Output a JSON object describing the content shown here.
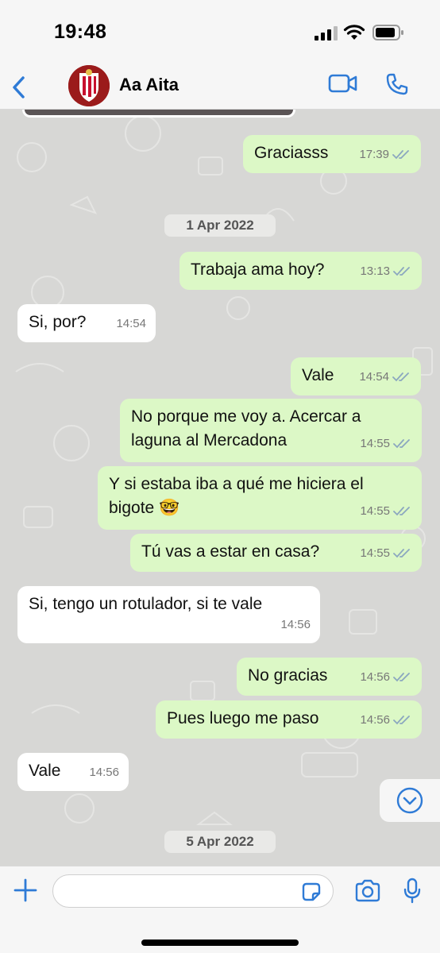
{
  "status_bar": {
    "time": "19:48"
  },
  "header": {
    "contact_name": "Aa Aita"
  },
  "colors": {
    "accent": "#2f7bd6",
    "outgoing_bubble": "#dcf8c6",
    "incoming_bubble": "#ffffff",
    "chat_background": "#d7d7d5",
    "read_ticks": "#6b8fb3"
  },
  "icons": {
    "back": "chevron-left-icon",
    "video": "video-camera-icon",
    "call": "phone-icon",
    "scroll_down": "chevron-down-circle-icon",
    "attach": "plus-icon",
    "sticker": "sticker-icon",
    "camera": "camera-icon",
    "mic": "microphone-icon"
  },
  "dates": [
    "1 Apr 2022",
    "5 Apr 2022"
  ],
  "messages": [
    {
      "dir": "out",
      "text": "Graciasss",
      "time": "17:39"
    },
    {
      "dir": "out",
      "text": "Trabaja ama hoy?",
      "time": "13:13"
    },
    {
      "dir": "in",
      "text": "Si, por?",
      "time": "14:54"
    },
    {
      "dir": "out",
      "text": "Vale",
      "time": "14:54"
    },
    {
      "dir": "out",
      "text": "No porque me voy a. Acercar a laguna al Mercadona",
      "time": "14:55"
    },
    {
      "dir": "out",
      "text": "Y si estaba iba a qué me hiciera el bigote 🤓",
      "time": "14:55"
    },
    {
      "dir": "out",
      "text": "Tú vas a estar en casa?",
      "time": "14:55"
    },
    {
      "dir": "in",
      "text": "Si, tengo un rotulador, si te vale",
      "time": "14:56"
    },
    {
      "dir": "out",
      "text": "No gracias",
      "time": "14:56"
    },
    {
      "dir": "out",
      "text": "Pues luego me paso",
      "time": "14:56"
    },
    {
      "dir": "in",
      "text": "Vale",
      "time": "14:56"
    }
  ],
  "composer": {
    "placeholder": "",
    "value": ""
  }
}
